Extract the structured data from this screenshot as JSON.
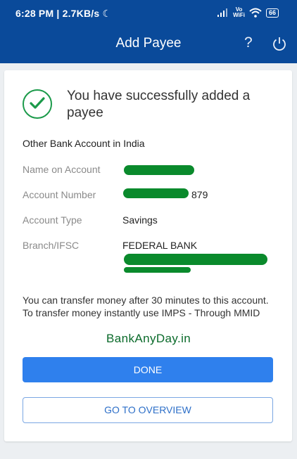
{
  "status_bar": {
    "time_speed": "6:28 PM | 2.7KB/s",
    "moon_glyph": "☾",
    "vo_line1": "Vo",
    "vo_line2": "WiFi",
    "battery": "66"
  },
  "app_bar": {
    "title": "Add Payee",
    "help_glyph": "?"
  },
  "success": {
    "message": "You have successfully added a payee"
  },
  "section_title": "Other Bank Account in India",
  "details": {
    "name_label": "Name on Account",
    "account_number_label": "Account Number",
    "account_number_suffix": "879",
    "account_type_label": "Account Type",
    "account_type_value": "Savings",
    "branch_label": "Branch/IFSC",
    "branch_value": "FEDERAL BANK"
  },
  "note": "You can transfer money after 30 minutes to this account. To transfer money instantly use IMPS - Through MMID",
  "watermark": "BankAnyDay.in",
  "buttons": {
    "done": "DONE",
    "overview": "GO TO OVERVIEW"
  },
  "colors": {
    "brand": "#0a4a9a",
    "primary_button": "#2f80ed",
    "success": "#1b9a4a",
    "redaction": "#0a8a2c"
  }
}
